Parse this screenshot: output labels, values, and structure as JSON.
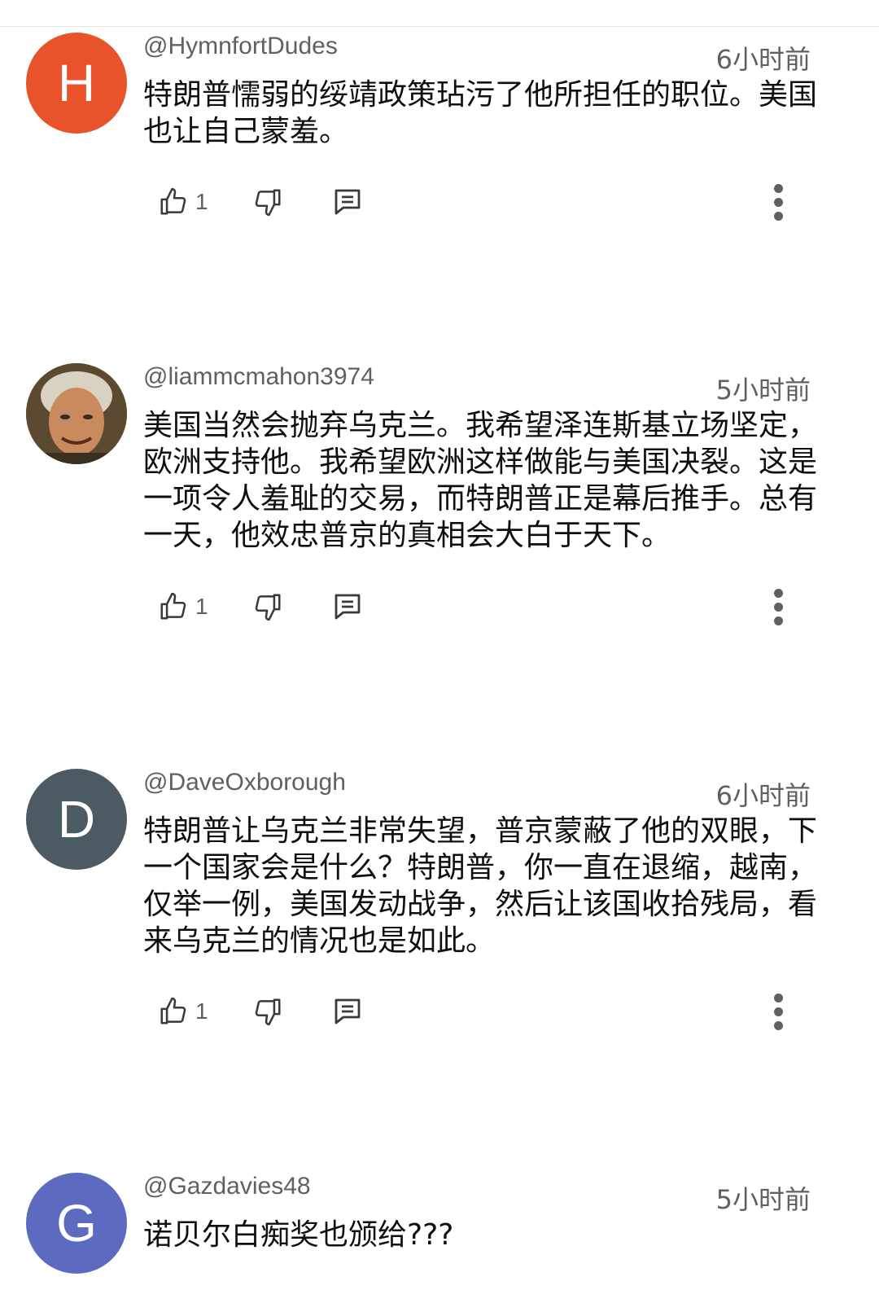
{
  "comments": [
    {
      "avatar_letter": "H",
      "avatar_color": "#e8532b",
      "handle": "@HymnfortDudes",
      "time": "6小时前",
      "text": "特朗普懦弱的绥靖政策玷污了他所担任的职位。美国也让自己蒙羞。",
      "likes": "1"
    },
    {
      "avatar_letter": "",
      "avatar_color": "#6b5a3a",
      "handle": "@liammcmahon3974",
      "time": "5小时前",
      "text": "美国当然会抛弃乌克兰。我希望泽连斯基立场坚定，欧洲支持他。我希望欧洲这样做能与美国决裂。这是一项令人羞耻的交易，而特朗普正是幕后推手。总有一天，他效忠普京的真相会大白于天下。",
      "likes": "1"
    },
    {
      "avatar_letter": "D",
      "avatar_color": "#4c5a64",
      "handle": "@DaveOxborough",
      "time": "6小时前",
      "text": "特朗普让乌克兰非常失望，普京蒙蔽了他的双眼，下一个国家会是什么？特朗普，你一直在退缩，越南，仅举一例，美国发动战争，然后让该国收拾残局，看来乌克兰的情况也是如此。",
      "likes": "1"
    },
    {
      "avatar_letter": "G",
      "avatar_color": "#5c6bc0",
      "handle": "@Gazdavies48",
      "time": "5小时前",
      "text": "诺贝尔白痴奖也颁给???",
      "likes": ""
    }
  ],
  "icons": {
    "like": "thumbs-up-icon",
    "dislike": "thumbs-down-icon",
    "reply": "comment-icon",
    "more": "more-vertical-icon"
  }
}
